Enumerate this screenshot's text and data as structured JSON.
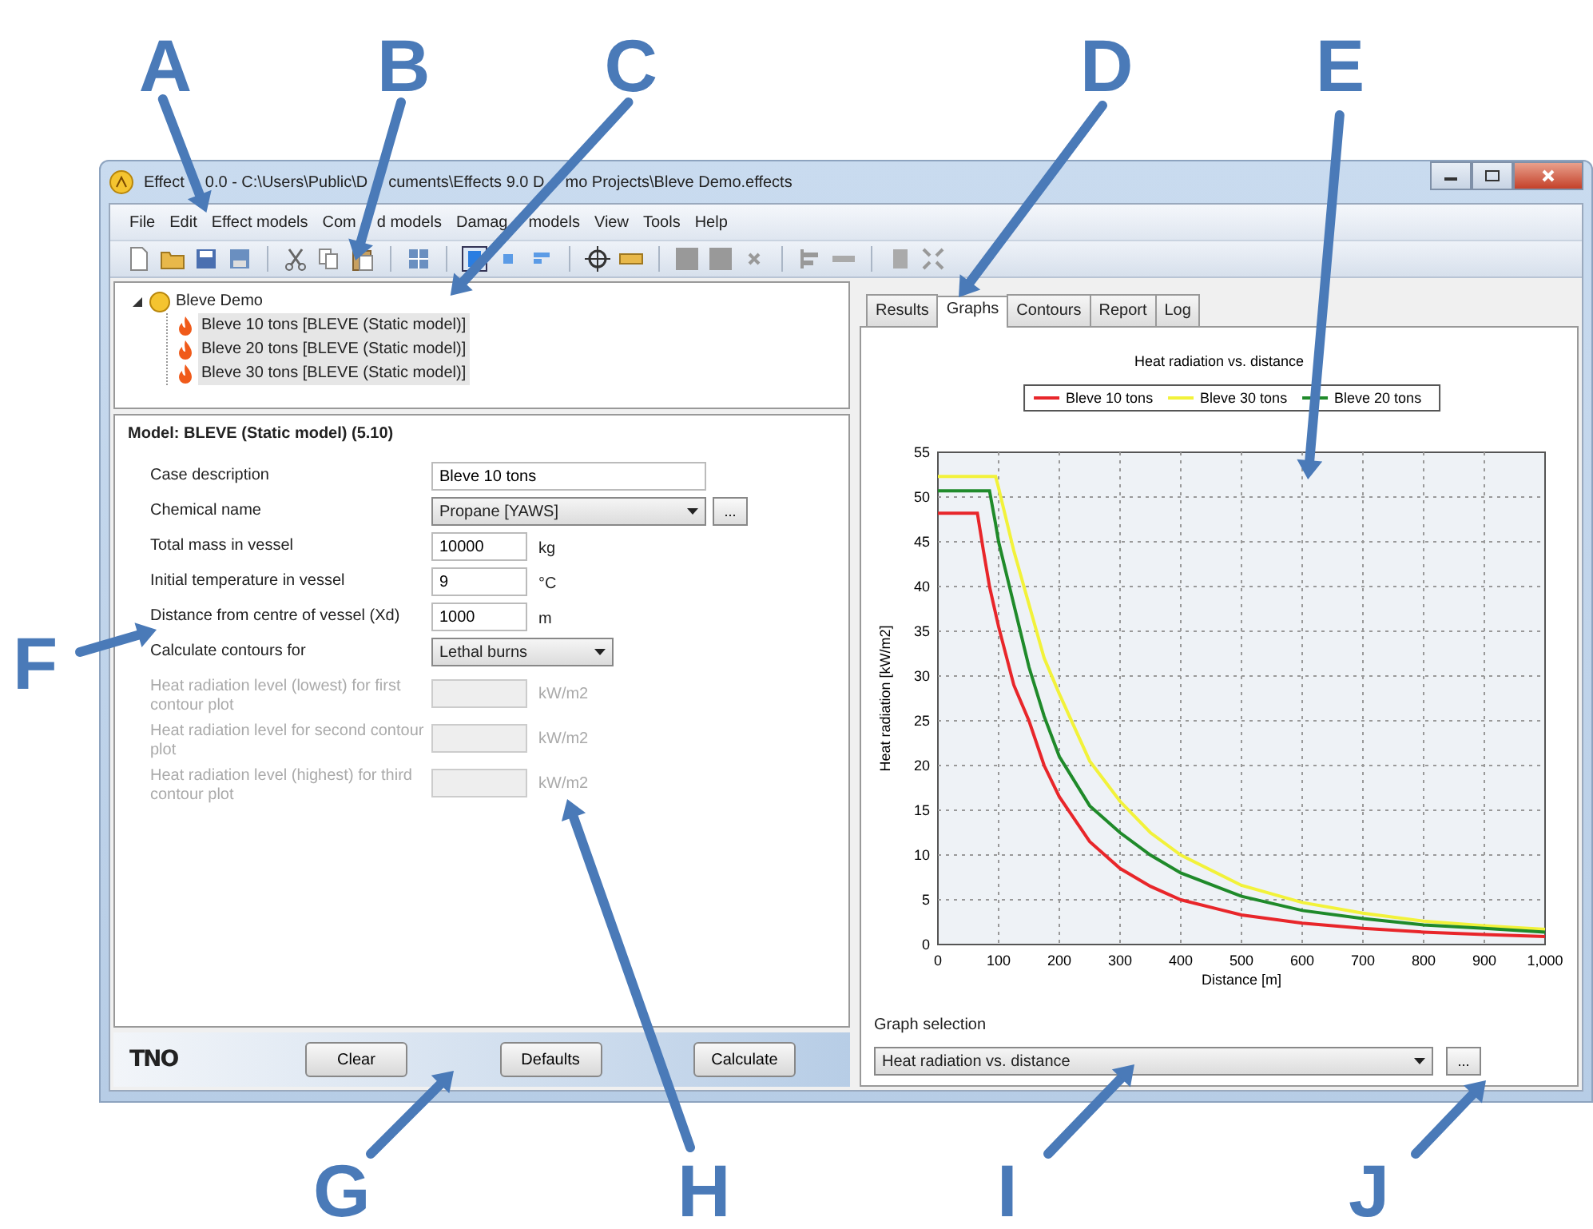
{
  "callouts": [
    {
      "letter": "A"
    },
    {
      "letter": "B"
    },
    {
      "letter": "C"
    },
    {
      "letter": "D"
    },
    {
      "letter": "E"
    },
    {
      "letter": "F"
    },
    {
      "letter": "G"
    },
    {
      "letter": "H"
    },
    {
      "letter": "I"
    },
    {
      "letter": "J"
    }
  ],
  "window": {
    "title_parts": [
      "Effect",
      "0.0 - C:\\Users\\Public\\D",
      "cuments\\Effects 9.0 D",
      "mo Projects\\Bleve Demo.effects"
    ]
  },
  "menu": [
    {
      "parts": [
        "File"
      ]
    },
    {
      "parts": [
        "Edit"
      ]
    },
    {
      "parts": [
        "Effect models"
      ]
    },
    {
      "parts": [
        "Com",
        "d models"
      ]
    },
    {
      "parts": [
        "Damag",
        "models"
      ]
    },
    {
      "parts": [
        "View"
      ]
    },
    {
      "parts": [
        "Tools"
      ]
    },
    {
      "parts": [
        "Help"
      ]
    }
  ],
  "tree": {
    "label": "Bleve Demo",
    "expanded": true,
    "children": [
      {
        "label": "Bleve 10 tons [BLEVE (Static model)]"
      },
      {
        "label": "Bleve 20 tons [BLEVE (Static model)]"
      },
      {
        "label": "Bleve 30 tons [BLEVE (Static model)]"
      }
    ]
  },
  "model": {
    "title": "Model: BLEVE (Static model) (5.10)",
    "fields": [
      {
        "kind": "text",
        "label": "Case description",
        "value": "Bleve 10 tons",
        "disabled": false
      },
      {
        "kind": "select",
        "label": "Chemical name",
        "value": "Propane [YAWS]",
        "browse": "...",
        "disabled": false
      },
      {
        "kind": "number",
        "label": "Total mass in vessel",
        "value": "10000",
        "unit": "kg",
        "disabled": false
      },
      {
        "kind": "number",
        "label": "Initial temperature in vessel",
        "value": "9",
        "unit": "°C",
        "disabled": false
      },
      {
        "kind": "number",
        "label": "Distance from centre of vessel (Xd)",
        "value": "1000",
        "unit": "m",
        "disabled": false
      },
      {
        "kind": "dropdown",
        "label": "Calculate contours for",
        "value": "Lethal burns",
        "disabled": false
      },
      {
        "kind": "number",
        "label": "Heat radiation level (lowest) for first contour plot",
        "unit": "kW/m2",
        "disabled": true
      },
      {
        "kind": "number",
        "label": "Heat radiation level for second contour plot",
        "unit": "kW/m2",
        "disabled": true
      },
      {
        "kind": "number",
        "label": "Heat radiation level (highest) for third contour plot",
        "unit": "kW/m2",
        "disabled": true
      }
    ]
  },
  "footer": {
    "logo": "TNO",
    "buttons": [
      "Clear",
      "Defaults",
      "Calculate"
    ]
  },
  "results": {
    "tabs": [
      {
        "label": "Results",
        "selected": false
      },
      {
        "label": "Graphs",
        "selected": true
      },
      {
        "label": "Contours",
        "selected": false
      },
      {
        "label": "Report",
        "selected": false
      },
      {
        "label": "Log",
        "selected": false
      }
    ],
    "chart_data": {
      "type": "line",
      "title": "Heat radiation vs. distance",
      "xlabel": "Distance [m]",
      "ylabel": "Heat radiation [kW/m2]",
      "x": [
        0,
        50,
        65,
        75,
        85,
        95,
        100,
        125,
        150,
        175,
        200,
        250,
        300,
        350,
        400,
        500,
        600,
        700,
        800,
        900,
        1000
      ],
      "series": [
        {
          "name": "Bleve 10 tons",
          "color": "#e8262a",
          "values": [
            48.2,
            48.2,
            48.2,
            44,
            40,
            37,
            35.5,
            29,
            25,
            20,
            16.5,
            11.5,
            8.5,
            6.5,
            5,
            3.3,
            2.4,
            1.8,
            1.4,
            1.1,
            0.9
          ]
        },
        {
          "name": "Bleve 30 tons",
          "color": "#f2f23a",
          "values": [
            52.3,
            52.3,
            52.3,
            52.3,
            52.3,
            52.3,
            51,
            44,
            38,
            32,
            28,
            20.5,
            16,
            12.5,
            10,
            6.6,
            4.7,
            3.5,
            2.6,
            2.1,
            1.7
          ]
        },
        {
          "name": "Bleve 20 tons",
          "color": "#1f8a2a",
          "values": [
            50.7,
            50.7,
            50.7,
            50.7,
            50.7,
            47,
            45,
            38,
            31,
            25.5,
            21,
            15.5,
            12.5,
            10,
            8,
            5.4,
            3.8,
            2.9,
            2.2,
            1.8,
            1.4
          ]
        }
      ],
      "xlim": [
        0,
        1000
      ],
      "ylim": [
        0,
        55
      ],
      "grid": true,
      "legend": true,
      "xticks": [
        0,
        100,
        200,
        300,
        400,
        500,
        600,
        700,
        800,
        900,
        {
          "value": 1000,
          "label": "1,000"
        }
      ],
      "yticks": [
        0,
        5,
        10,
        15,
        20,
        25,
        30,
        35,
        40,
        45,
        50,
        55
      ]
    },
    "graph_selection": {
      "label": "Graph selection",
      "value": "Heat radiation vs. distance",
      "browse": "..."
    }
  }
}
